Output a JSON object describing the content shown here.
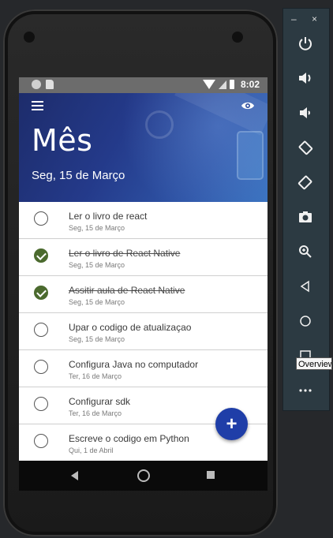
{
  "status_bar": {
    "time": "8:02"
  },
  "header": {
    "title": "Mês",
    "subtitle": "Seg, 15 de Março"
  },
  "tasks": [
    {
      "title": "Ler o livro de react",
      "date": "Seg, 15 de Março",
      "done": false
    },
    {
      "title": "Ler o livro de React Native",
      "date": "Seg, 15 de Março",
      "done": true
    },
    {
      "title": "Assitir aula de React Native",
      "date": "Seg, 15 de Março",
      "done": true
    },
    {
      "title": "Upar o codigo de atualizaçao",
      "date": "Seg, 15 de Março",
      "done": false
    },
    {
      "title": "Configura Java no computador",
      "date": "Ter, 16 de Março",
      "done": false
    },
    {
      "title": "Configurar sdk",
      "date": "Ter, 16 de Março",
      "done": false
    },
    {
      "title": "Escreve o codigo em Python",
      "date": "Qui, 1 de Abril",
      "done": false
    }
  ],
  "fab": {
    "label": "+"
  },
  "emulator": {
    "minimize_label": "–",
    "close_label": "×",
    "tooltip": "Overview"
  },
  "colors": {
    "accent": "#1f3ea8",
    "done_check": "#4b6a2e",
    "header_gradient_start": "#1d2c6b",
    "header_gradient_end": "#3a73c0"
  }
}
